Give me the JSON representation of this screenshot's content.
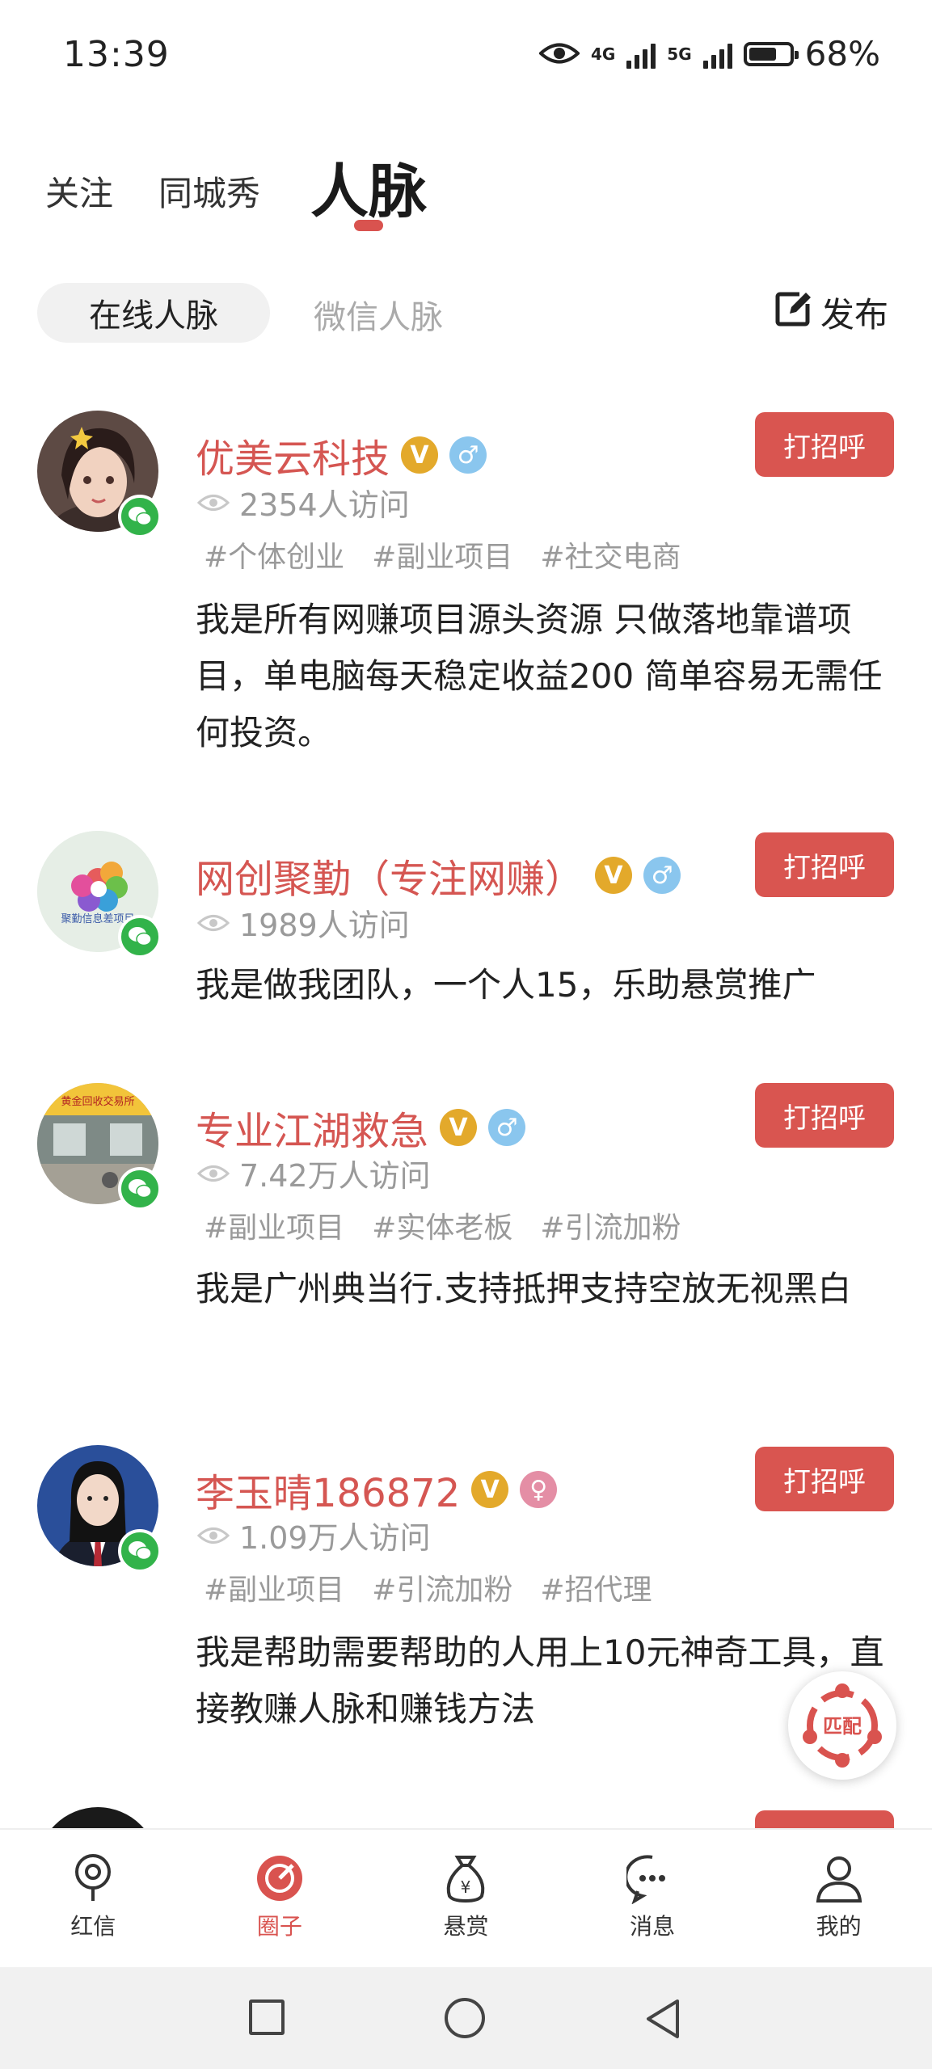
{
  "status_bar": {
    "time": "13:39",
    "net1": "4G",
    "net2": "5G",
    "battery": "68%",
    "battery_level": 0.68
  },
  "top_tabs": [
    {
      "label": "关注"
    },
    {
      "label": "同城秀"
    },
    {
      "label": "人脉"
    }
  ],
  "sub_tabs": {
    "online": "在线人脉",
    "wechat": "微信人脉",
    "publish": "发布"
  },
  "cards": [
    {
      "name": "优美云科技",
      "verified": "V",
      "gender": "male",
      "visits": "2354人访问",
      "tags": [
        "#个体创业",
        "#副业项目",
        "#社交电商"
      ],
      "bio": "我是所有网赚项目源头资源 只做落地靠谱项目，单电脑每天稳定收益200 简单容易无需任何投资。",
      "button": "打招呼"
    },
    {
      "name": "网创聚勤（专注网赚）",
      "verified": "V",
      "gender": "male",
      "visits": "1989人访问",
      "tags": [],
      "bio": "我是做我团队，一个人15，乐助悬赏推广",
      "button": "打招呼",
      "avatar_text": "聚勤信息差项目"
    },
    {
      "name": "专业江湖救急",
      "verified": "V",
      "gender": "male",
      "visits": "7.42万人访问",
      "tags": [
        "#副业项目",
        "#实体老板",
        "#引流加粉"
      ],
      "bio": "我是广州典当行.支持抵押支持空放无视黑白",
      "button": "打招呼",
      "avatar_text": "黄金回收交易所"
    },
    {
      "name": "李玉晴186872",
      "verified": "V",
      "gender": "female",
      "visits": "1.09万人访问",
      "tags": [
        "#副业项目",
        "#引流加粉",
        "#招代理"
      ],
      "bio": "我是帮助需要帮助的人用上10元神奇工具，直接教赚人脉和赚钱方法",
      "button": "打招呼"
    }
  ],
  "match_button": "匹配",
  "bottom_nav": [
    {
      "label": "红信",
      "icon": "location-pin-icon"
    },
    {
      "label": "圈子",
      "icon": "circle-compass-icon",
      "active": true
    },
    {
      "label": "悬赏",
      "icon": "money-bag-icon"
    },
    {
      "label": "消息",
      "icon": "chat-bubble-icon"
    },
    {
      "label": "我的",
      "icon": "person-icon"
    }
  ],
  "colors": {
    "accent": "#d95550",
    "name": "#d55652",
    "wechat": "#32b34a",
    "verified": "#e3a92b",
    "male": "#8ac6ee",
    "female": "#e48ea5"
  }
}
